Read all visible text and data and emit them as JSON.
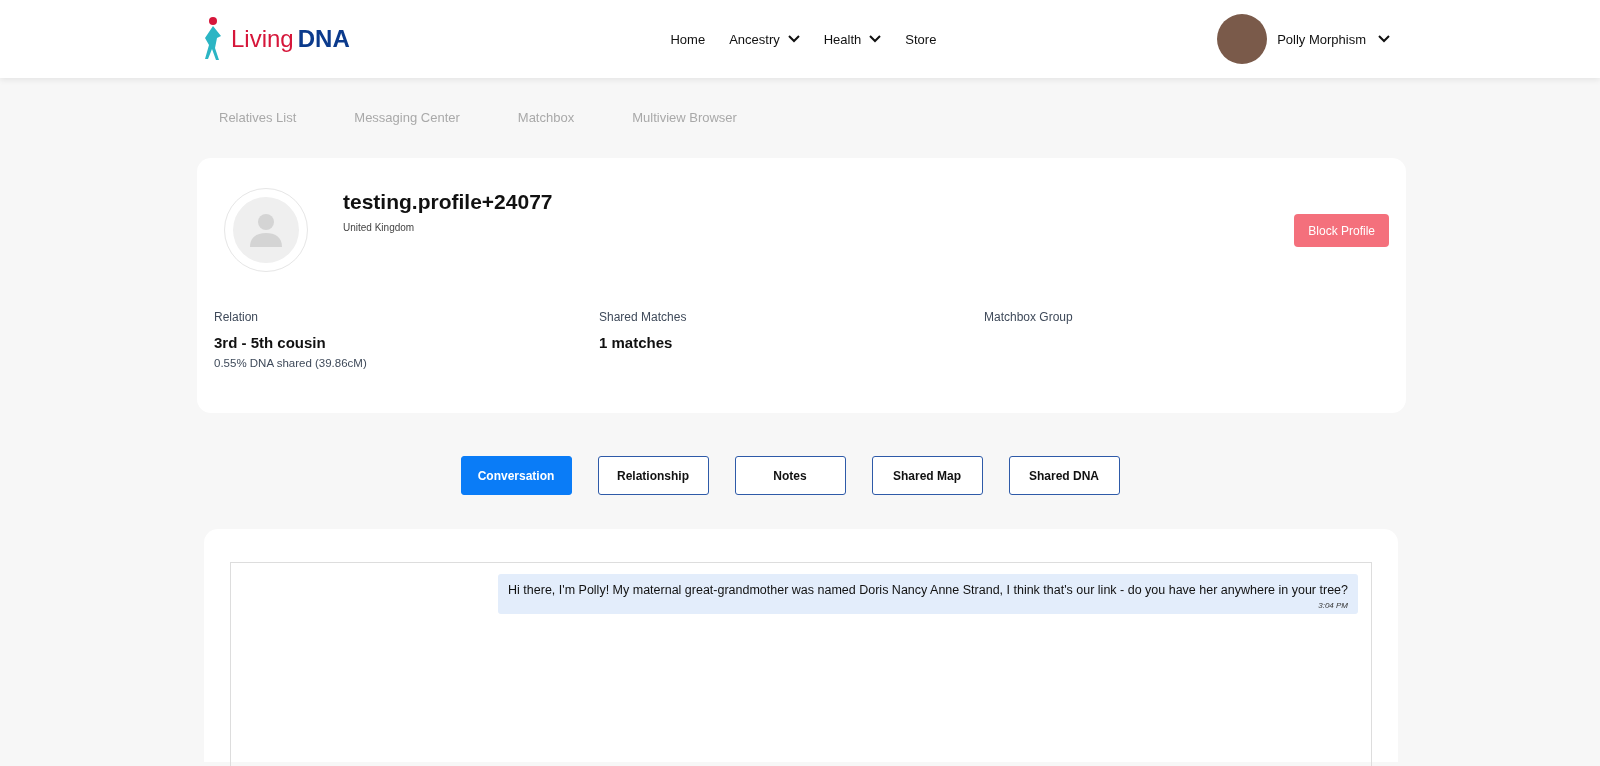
{
  "logo": {
    "word_1": "Living",
    "word_2": "DNA"
  },
  "nav": [
    {
      "label": "Home",
      "dropdown": false
    },
    {
      "label": "Ancestry",
      "dropdown": true
    },
    {
      "label": "Health",
      "dropdown": true
    },
    {
      "label": "Store",
      "dropdown": false
    }
  ],
  "user": {
    "name": "Polly Morphism"
  },
  "subnav": [
    "Relatives List",
    "Messaging Center",
    "Matchbox",
    "Multiview Browser"
  ],
  "profile": {
    "name": "testing.profile+24077",
    "location": "United Kingdom",
    "block_button": "Block Profile",
    "stats": [
      {
        "label": "Relation",
        "value": "3rd - 5th cousin",
        "detail": "0.55% DNA shared (39.86cM)"
      },
      {
        "label": "Shared Matches",
        "value": "1 matches"
      },
      {
        "label": "Matchbox Group"
      }
    ]
  },
  "tabs": [
    {
      "label": "Conversation",
      "selected": true
    },
    {
      "label": "Relationship",
      "selected": false
    },
    {
      "label": "Notes",
      "selected": false
    },
    {
      "label": "Shared Map",
      "selected": false
    },
    {
      "label": "Shared DNA",
      "selected": false
    }
  ],
  "messages": [
    {
      "text": "Hi there, I'm Polly! My maternal great-grandmother was named Doris Nancy Anne Strand, I think that's our link - do you have her anywhere in your tree?",
      "time": "3:04 PM"
    }
  ]
}
